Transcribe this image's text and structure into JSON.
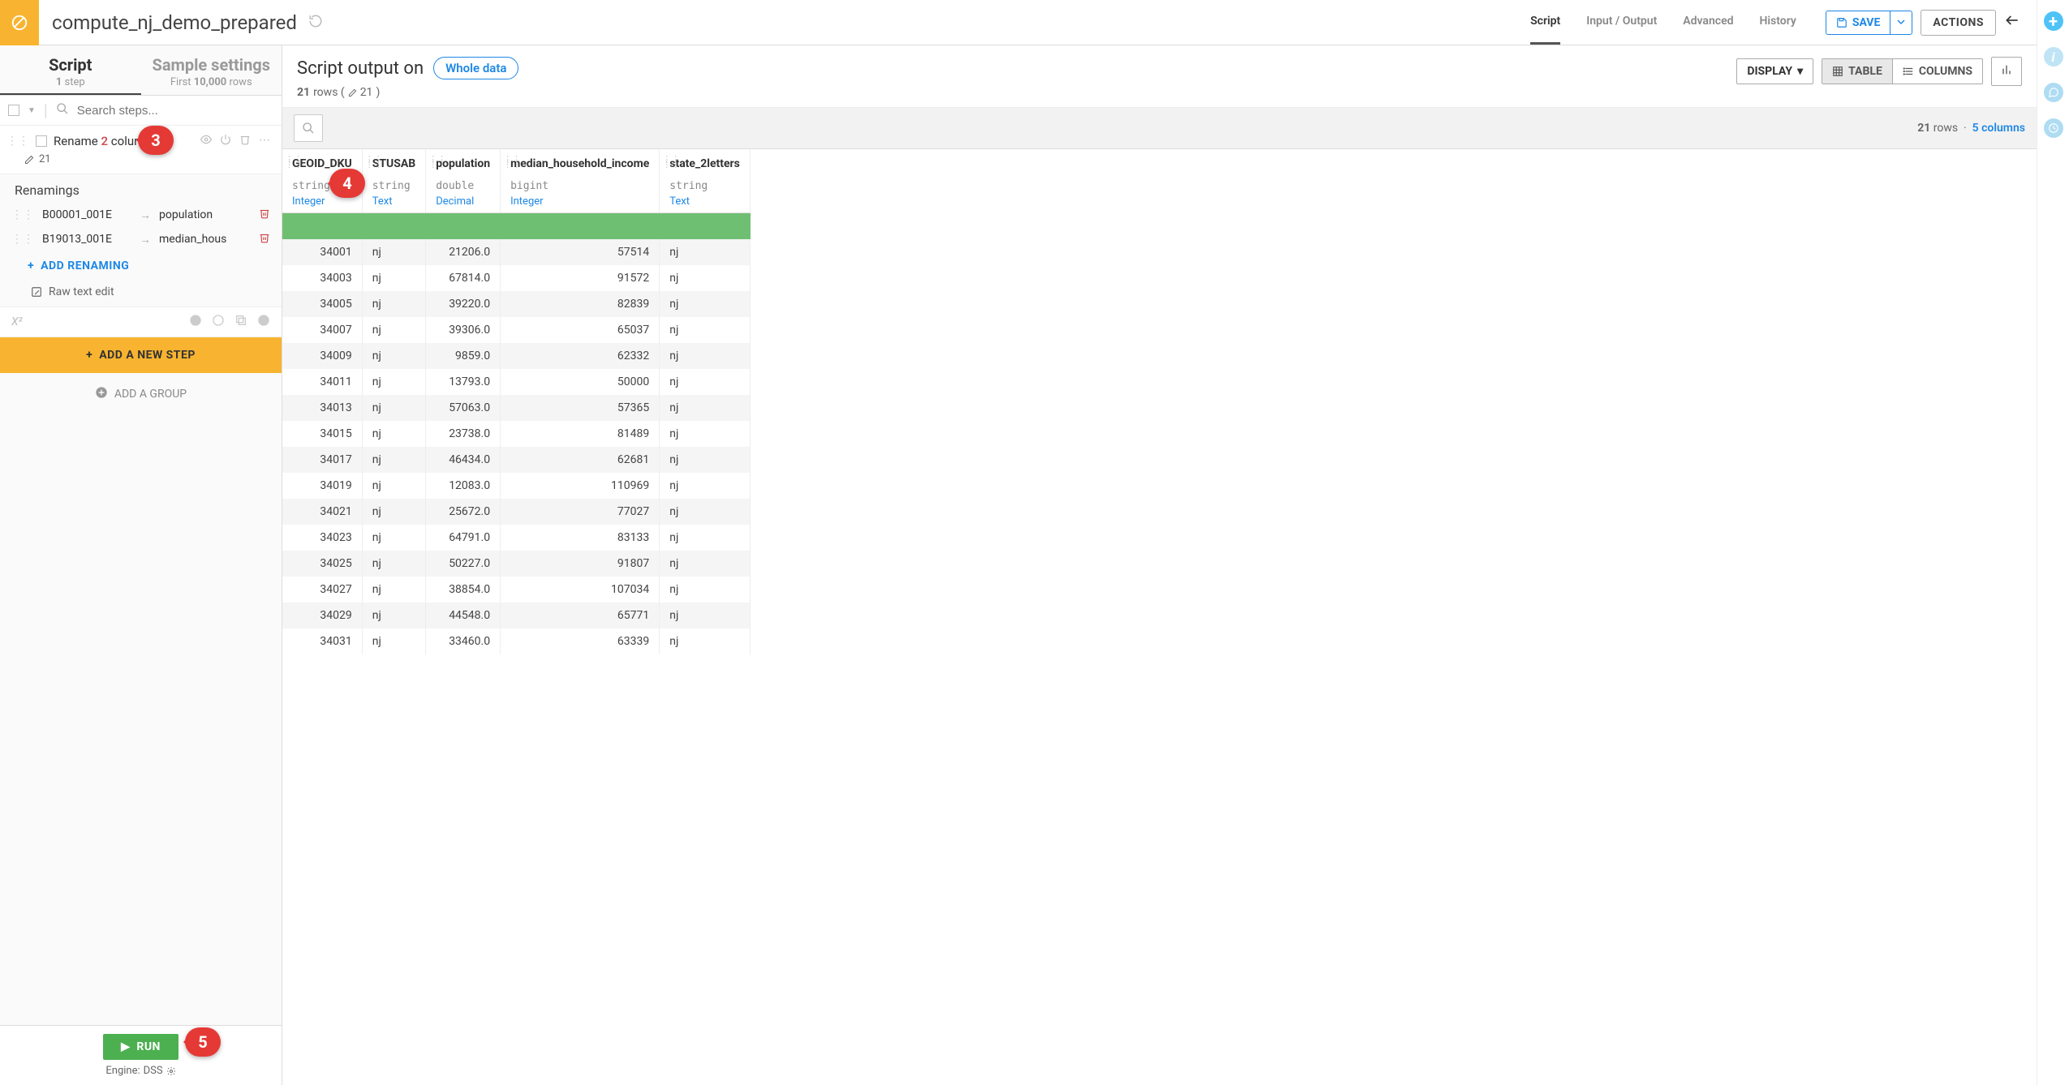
{
  "header": {
    "title": "compute_nj_demo_prepared",
    "tabs": [
      "Script",
      "Input / Output",
      "Advanced",
      "History"
    ],
    "active_tab": "Script",
    "save_label": "SAVE",
    "actions_label": "ACTIONS"
  },
  "sidebar": {
    "tabs": [
      {
        "title": "Script",
        "sub_prefix": "1",
        "sub_suffix": " step"
      },
      {
        "title": "Sample settings",
        "sub_prefix": "First ",
        "sub_bold": "10,000",
        "sub_suffix": " rows"
      }
    ],
    "active_tab": "Script",
    "search_placeholder": "Search steps...",
    "step": {
      "title_pre": "Rename ",
      "title_num": "2",
      "title_post": " columns",
      "count": "21"
    },
    "renamings_title": "Renamings",
    "renamings": [
      {
        "from": "B00001_001E",
        "to": "population"
      },
      {
        "from": "B19013_001E",
        "to": "median_hous"
      }
    ],
    "add_renaming": "ADD RENAMING",
    "raw_edit": "Raw text edit",
    "new_step": "ADD A NEW STEP",
    "add_group": "ADD A GROUP",
    "run": "RUN",
    "engine_prefix": "Engine: ",
    "engine": "DSS"
  },
  "output": {
    "title": "Script output on",
    "chip": "Whole data",
    "sub_rows_n": "21",
    "sub_rows_label": " rows  ( ",
    "sub_edited": "21",
    "sub_close": " )",
    "display": "DISPLAY",
    "seg_table": "TABLE",
    "seg_columns": "COLUMNS",
    "counts_rows_n": "21",
    "counts_rows_label": " rows",
    "counts_cols_n": "5",
    "counts_cols_label": " columns"
  },
  "columns": [
    {
      "name": "GEOID_DKU",
      "type": "string",
      "meaning": "Integer",
      "align": "num"
    },
    {
      "name": "STUSAB",
      "type": "string",
      "meaning": "Text",
      "align": ""
    },
    {
      "name": "population",
      "type": "double",
      "meaning": "Decimal",
      "align": "num"
    },
    {
      "name": "median_household_income",
      "type": "bigint",
      "meaning": "Integer",
      "align": "num"
    },
    {
      "name": "state_2letters",
      "type": "string",
      "meaning": "Text",
      "align": ""
    }
  ],
  "rows": [
    [
      "34001",
      "nj",
      "21206.0",
      "57514",
      "nj"
    ],
    [
      "34003",
      "nj",
      "67814.0",
      "91572",
      "nj"
    ],
    [
      "34005",
      "nj",
      "39220.0",
      "82839",
      "nj"
    ],
    [
      "34007",
      "nj",
      "39306.0",
      "65037",
      "nj"
    ],
    [
      "34009",
      "nj",
      "9859.0",
      "62332",
      "nj"
    ],
    [
      "34011",
      "nj",
      "13793.0",
      "50000",
      "nj"
    ],
    [
      "34013",
      "nj",
      "57063.0",
      "57365",
      "nj"
    ],
    [
      "34015",
      "nj",
      "23738.0",
      "81489",
      "nj"
    ],
    [
      "34017",
      "nj",
      "46434.0",
      "62681",
      "nj"
    ],
    [
      "34019",
      "nj",
      "12083.0",
      "110969",
      "nj"
    ],
    [
      "34021",
      "nj",
      "25672.0",
      "77027",
      "nj"
    ],
    [
      "34023",
      "nj",
      "64791.0",
      "83133",
      "nj"
    ],
    [
      "34025",
      "nj",
      "50227.0",
      "91807",
      "nj"
    ],
    [
      "34027",
      "nj",
      "38854.0",
      "107034",
      "nj"
    ],
    [
      "34029",
      "nj",
      "44548.0",
      "65771",
      "nj"
    ],
    [
      "34031",
      "nj",
      "33460.0",
      "63339",
      "nj"
    ]
  ],
  "callouts": {
    "c3": "3",
    "c4": "4",
    "c5": "5"
  }
}
